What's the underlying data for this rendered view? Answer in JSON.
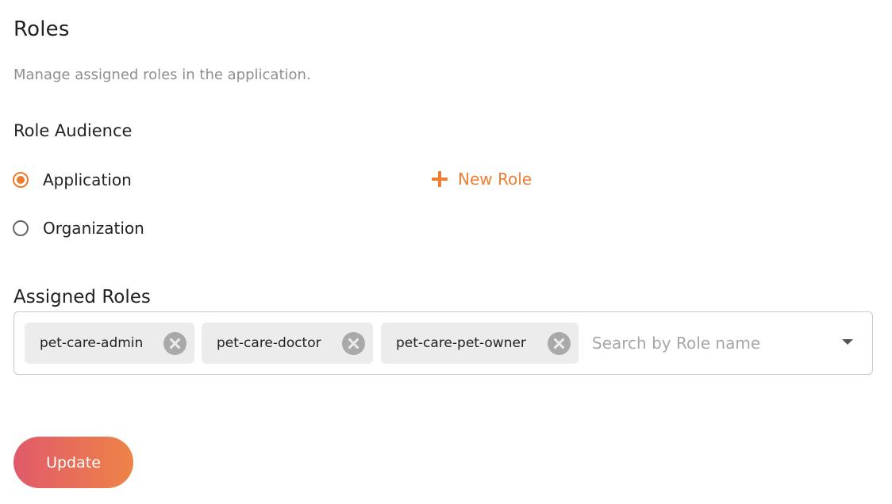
{
  "header": {
    "title": "Roles",
    "description": "Manage assigned roles in the application."
  },
  "role_audience": {
    "title": "Role Audience",
    "options": [
      {
        "label": "Application",
        "selected": true
      },
      {
        "label": "Organization",
        "selected": false
      }
    ],
    "new_role_label": "New Role"
  },
  "assigned_roles": {
    "label": "Assigned Roles",
    "chips": [
      {
        "label": "pet-care-admin"
      },
      {
        "label": "pet-care-doctor"
      },
      {
        "label": "pet-care-pet-owner"
      }
    ],
    "search_value": "",
    "search_placeholder": "Search by Role name"
  },
  "actions": {
    "update_label": "Update"
  },
  "colors": {
    "accent": "#f07a2c",
    "button_gradient_start": "#e05a6a",
    "button_gradient_end": "#ee8348",
    "chip_background": "#ececec"
  },
  "icons": {
    "new_role": "plus-icon",
    "chip_remove": "close-circle-icon",
    "dropdown": "caret-down-icon"
  }
}
